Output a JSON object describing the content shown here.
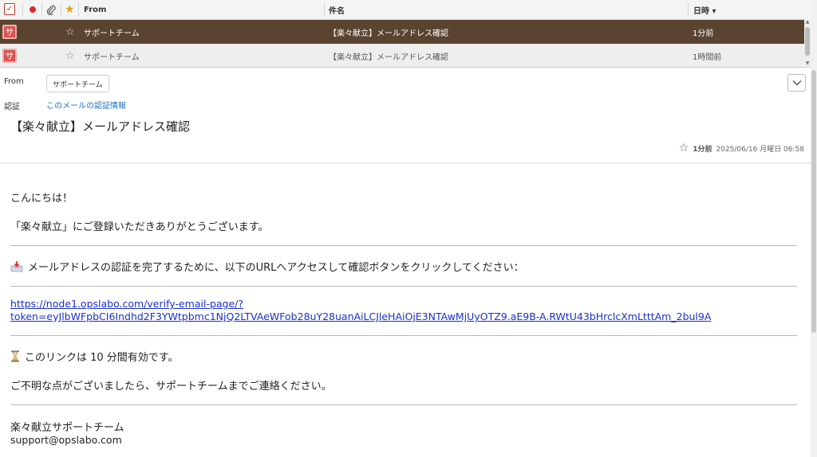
{
  "list": {
    "columns": {
      "from": "From",
      "subject": "件名",
      "date": "日時 ▾"
    },
    "rows": [
      {
        "avatar": "サ",
        "from": "サポートチーム",
        "subject": "【楽々献立】メールアドレス確認",
        "date": "1分前"
      },
      {
        "avatar": "サ",
        "from": "サポートチーム",
        "subject": "【楽々献立】メールアドレス確認",
        "date": "1時間前"
      }
    ]
  },
  "header": {
    "from_label": "From",
    "from_value": "サポートチーム",
    "auth_label": "認証",
    "auth_link": "このメールの認証情報",
    "subject": "【楽々献立】メールアドレス確認",
    "ago": "1分前",
    "datetime": "2025/06/16 月曜日 06:58"
  },
  "body": {
    "greeting": "こんにちは！",
    "thanks": "「楽々献立」にご登録いただきありがとうございます。",
    "instruction": "メールアドレスの認証を完了するために、以下のURLへアクセスして確認ボタンをクリックしてください：",
    "url_line1": "https://node1.opslabo.com/verify-email-page/?",
    "url_line2": "token=eyJlbWFpbCI6Indhd2F3YWtpbmc1NjQ2LTVAeWFob28uY28uanAiLCJleHAiOjE3NTAwMjUyOTZ9.aE9B-A.RWtU43bHrclcXmLtttAm_2bul9A",
    "validity": "このリンクは 10 分間有効です。",
    "contact": "ご不明な点がございましたら、サポートチームまでご連絡ください。",
    "sig_team": "楽々献立サポートチーム",
    "sig_email": "support@opslabo.com"
  }
}
